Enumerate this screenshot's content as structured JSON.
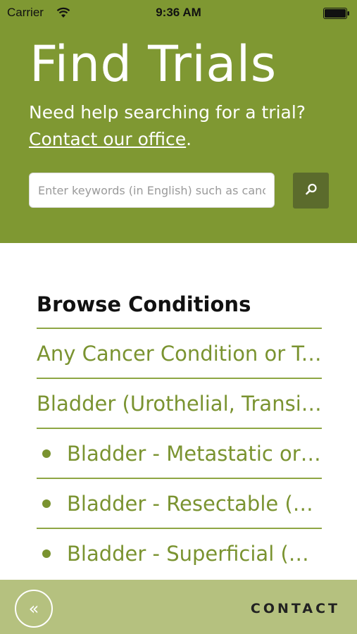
{
  "status_bar": {
    "carrier": "Carrier",
    "time": "9:36 AM"
  },
  "hero": {
    "title": "Find Trials",
    "subtitle_line1": "Need help searching for a trial?",
    "contact_link": "Contact our office",
    "contact_suffix": ".",
    "search_placeholder": "Enter keywords (in English) such as cancer type, drug name"
  },
  "browse": {
    "heading": "Browse Conditions",
    "items": [
      {
        "label": "Any Cancer Condition or Type"
      },
      {
        "label": "Bladder (Urothelial, Transitional Cell)"
      },
      {
        "label": "Bladder - Metastatic or Unresectable"
      },
      {
        "label": "Bladder - Resectable (Muscle-Invasive)"
      },
      {
        "label": "Bladder - Superficial (Non-Muscle-Invasive)"
      }
    ]
  },
  "footer": {
    "back_icon": "«",
    "contact": "CONTACT"
  },
  "colors": {
    "brand_green": "#7f9832",
    "link_green": "#7a9330",
    "search_button": "#5b6b2c",
    "footer_bg": "#b5c17f"
  }
}
